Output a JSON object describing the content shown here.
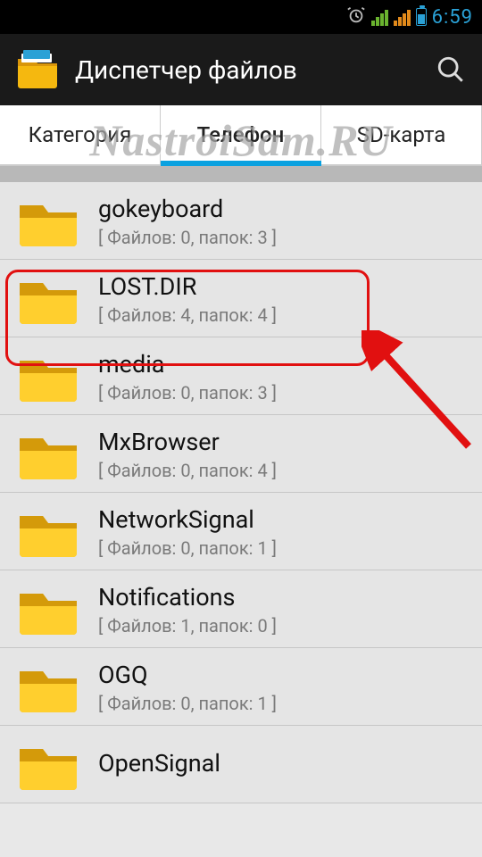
{
  "status": {
    "time": "6:59"
  },
  "header": {
    "title": "Диспетчер файлов"
  },
  "tabs": {
    "items": [
      {
        "label": "Категория"
      },
      {
        "label": "Телефон"
      },
      {
        "label": "SD-карта"
      }
    ],
    "active_index": 1
  },
  "list": {
    "items": [
      {
        "name": "gokeyboard",
        "meta": "[ Файлов: 0, папок: 3 ]"
      },
      {
        "name": "LOST.DIR",
        "meta": "[ Файлов: 4, папок: 4 ]",
        "highlighted": true
      },
      {
        "name": "media",
        "meta": "[ Файлов: 0, папок: 3 ]"
      },
      {
        "name": "MxBrowser",
        "meta": "[ Файлов: 0, папок: 4 ]"
      },
      {
        "name": "NetworkSignal",
        "meta": "[ Файлов: 0, папок: 1 ]"
      },
      {
        "name": "Notifications",
        "meta": "[ Файлов: 1, папок: 0 ]"
      },
      {
        "name": "OGQ",
        "meta": "[ Файлов: 0, папок: 1 ]"
      },
      {
        "name": "OpenSignal",
        "meta": ""
      }
    ]
  },
  "watermark": {
    "text": "NastroiSam.RU"
  }
}
